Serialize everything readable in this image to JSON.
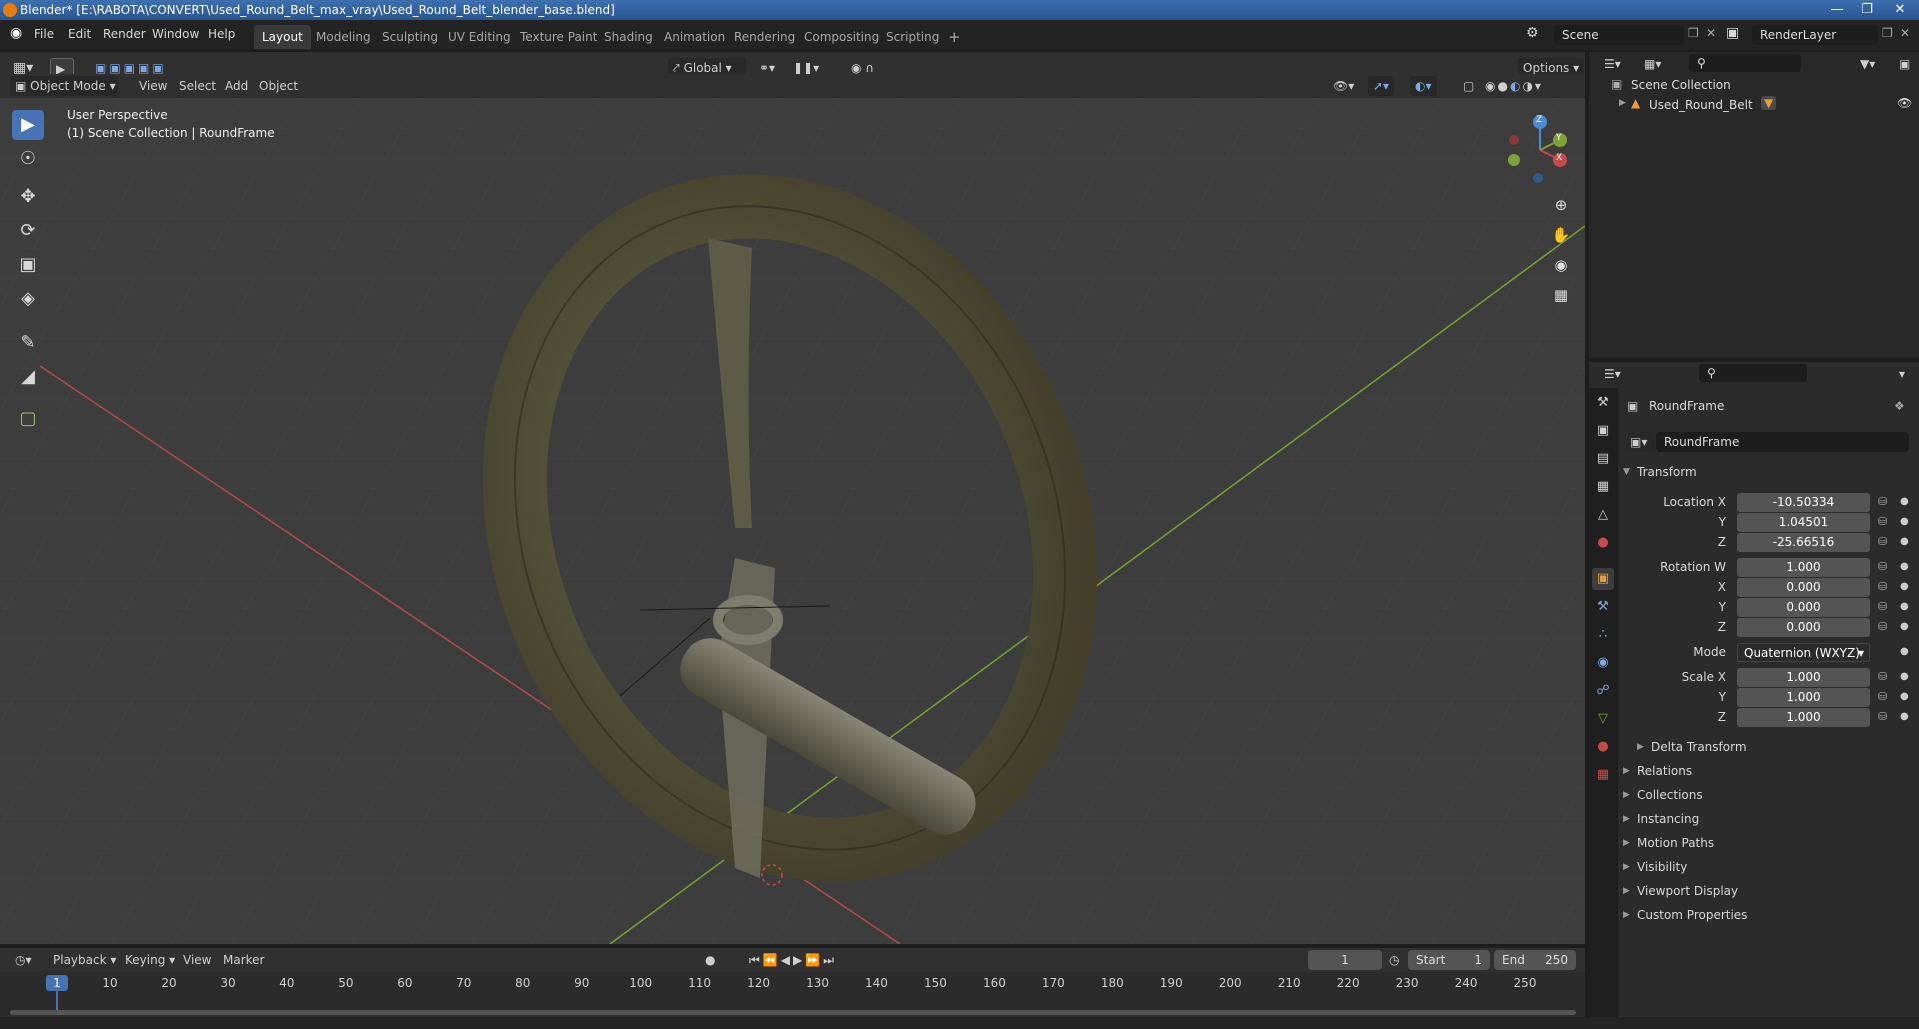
{
  "title_bar": {
    "title": "Blender* [E:\\RABOTA\\CONVERT\\Used_Round_Belt_max_vray\\Used_Round_Belt_blender_base.blend]"
  },
  "menu": {
    "items": [
      "File",
      "Edit",
      "Render",
      "Window",
      "Help"
    ]
  },
  "workspaces": {
    "tabs": [
      "Layout",
      "Modeling",
      "Sculpting",
      "UV Editing",
      "Texture Paint",
      "Shading",
      "Animation",
      "Rendering",
      "Compositing",
      "Scripting"
    ],
    "active": "Layout",
    "add": "+"
  },
  "scene": {
    "name": "Scene",
    "render_layer": "RenderLayer"
  },
  "viewport_header": {
    "mode": "Object Mode",
    "menus": [
      "View",
      "Select",
      "Add",
      "Object"
    ],
    "orientation": "Global",
    "options": "Options"
  },
  "viewport": {
    "overlay_line1": "User Perspective",
    "overlay_line2": "(1) Scene Collection | RoundFrame",
    "gizmo": {
      "z": "Z",
      "y": "Y",
      "x": "X"
    }
  },
  "outliner": {
    "root": "Scene Collection",
    "items": [
      {
        "label": "Used_Round_Belt"
      }
    ]
  },
  "properties": {
    "object_name": "RoundFrame",
    "datablock_name": "RoundFrame",
    "transform": {
      "header": "Transform",
      "location_label": "Location X",
      "location": [
        "-10.50334",
        "1.04501",
        "-25.66516"
      ],
      "rotation_label": "Rotation W",
      "rotation": [
        "1.000",
        "0.000",
        "0.000",
        "0.000"
      ],
      "mode_label": "Mode",
      "mode": "Quaternion (WXYZ)",
      "scale_label": "Scale X",
      "scale": [
        "1.000",
        "1.000",
        "1.000"
      ],
      "axis_y": "Y",
      "axis_z": "Z",
      "axis_x": "X",
      "delta": "Delta Transform"
    },
    "sections": [
      "Relations",
      "Collections",
      "Instancing",
      "Motion Paths",
      "Visibility",
      "Viewport Display",
      "Custom Properties"
    ]
  },
  "timeline": {
    "menus": [
      "Playback",
      "Keying",
      "View",
      "Marker"
    ],
    "current_frame": "1",
    "start_label": "Start",
    "start": "1",
    "end_label": "End",
    "end": "250",
    "ticks": [
      "1",
      "10",
      "20",
      "30",
      "40",
      "50",
      "60",
      "70",
      "80",
      "90",
      "100",
      "110",
      "120",
      "130",
      "140",
      "150",
      "160",
      "170",
      "180",
      "190",
      "200",
      "210",
      "220",
      "230",
      "240",
      "250"
    ]
  },
  "colors": {
    "accent": "#4772b3",
    "viewport_bg": "#3d3d3d",
    "x_axis": "#c84b4b",
    "y_axis": "#7ea336",
    "z_axis": "#4a8ad6",
    "object": "#5c5a3e"
  }
}
